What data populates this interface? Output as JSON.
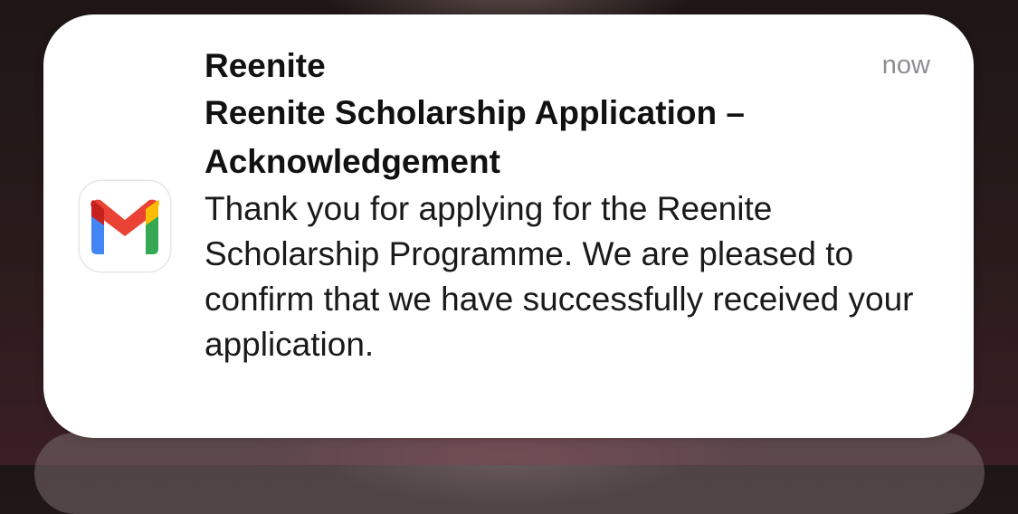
{
  "notification": {
    "app_name": "Reenite",
    "timestamp": "now",
    "subject": "Reenite Scholarship Application – Acknowledgement",
    "message": "Thank you for applying for the Reenite Scholarship Programme. We are pleased to confirm that we have successfully received your application.",
    "icon": "gmail-icon"
  },
  "colors": {
    "card_background": "#ffffff",
    "timestamp_text": "#8e8e93",
    "gmail_red": "#ea4335",
    "gmail_blue": "#4285f4",
    "gmail_green": "#34a853",
    "gmail_yellow": "#fbbc04"
  }
}
